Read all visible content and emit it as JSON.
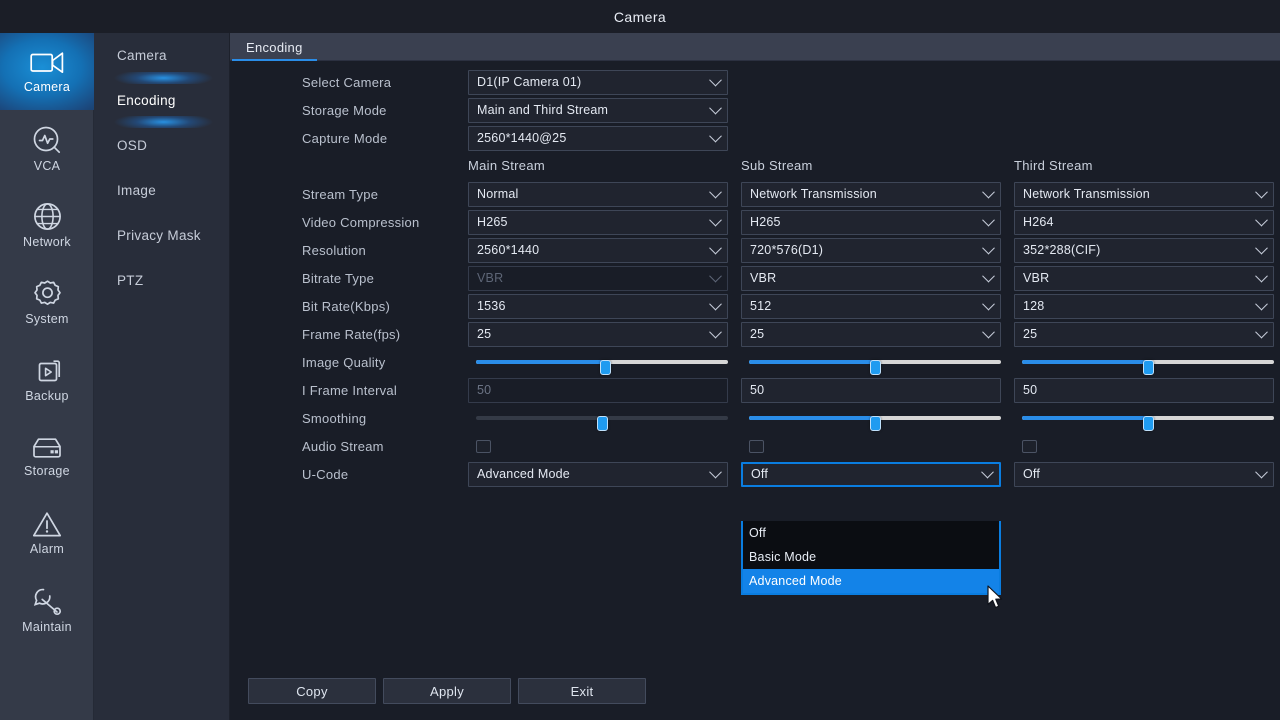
{
  "window": {
    "title": "Camera"
  },
  "rail": {
    "items": [
      {
        "label": "Camera",
        "icon": "camera-icon",
        "active": true
      },
      {
        "label": "VCA",
        "icon": "vca-icon",
        "active": false
      },
      {
        "label": "Network",
        "icon": "globe-icon",
        "active": false
      },
      {
        "label": "System",
        "icon": "gear-icon",
        "active": false
      },
      {
        "label": "Backup",
        "icon": "backup-icon",
        "active": false
      },
      {
        "label": "Storage",
        "icon": "storage-icon",
        "active": false
      },
      {
        "label": "Alarm",
        "icon": "warning-icon",
        "active": false
      },
      {
        "label": "Maintain",
        "icon": "wrench-icon",
        "active": false
      }
    ]
  },
  "submenu": {
    "items": [
      {
        "label": "Camera",
        "active": false
      },
      {
        "label": "Encoding",
        "active": true
      },
      {
        "label": "OSD",
        "active": false
      },
      {
        "label": "Image",
        "active": false
      },
      {
        "label": "Privacy Mask",
        "active": false
      },
      {
        "label": "PTZ",
        "active": false
      }
    ]
  },
  "tabs": [
    {
      "label": "Encoding",
      "active": true
    }
  ],
  "top_fields": [
    {
      "label": "Select Camera",
      "value": "D1(IP Camera 01)"
    },
    {
      "label": "Storage Mode",
      "value": "Main and Third Stream"
    },
    {
      "label": "Capture Mode",
      "value": "2560*1440@25"
    }
  ],
  "column_headers": [
    "Main Stream",
    "Sub Stream",
    "Third Stream"
  ],
  "rows": [
    {
      "label": "Stream Type",
      "cells": [
        {
          "type": "select",
          "value": "Normal",
          "disabled": false
        },
        {
          "type": "select",
          "value": "Network Transmission",
          "disabled": false
        },
        {
          "type": "select",
          "value": "Network Transmission",
          "disabled": false
        }
      ]
    },
    {
      "label": "Video Compression",
      "cells": [
        {
          "type": "select",
          "value": "H265",
          "disabled": false
        },
        {
          "type": "select",
          "value": "H265",
          "disabled": false
        },
        {
          "type": "select",
          "value": "H264",
          "disabled": false
        }
      ]
    },
    {
      "label": "Resolution",
      "cells": [
        {
          "type": "select",
          "value": "2560*1440",
          "disabled": false
        },
        {
          "type": "select",
          "value": "720*576(D1)",
          "disabled": false
        },
        {
          "type": "select",
          "value": "352*288(CIF)",
          "disabled": false
        }
      ]
    },
    {
      "label": "Bitrate Type",
      "cells": [
        {
          "type": "select",
          "value": "VBR",
          "disabled": true
        },
        {
          "type": "select",
          "value": "VBR",
          "disabled": false
        },
        {
          "type": "select",
          "value": "VBR",
          "disabled": false
        }
      ]
    },
    {
      "label": "Bit Rate(Kbps)",
      "cells": [
        {
          "type": "select",
          "value": "1536",
          "disabled": false
        },
        {
          "type": "select",
          "value": "512",
          "disabled": false
        },
        {
          "type": "select",
          "value": "128",
          "disabled": false
        }
      ]
    },
    {
      "label": "Frame Rate(fps)",
      "cells": [
        {
          "type": "select",
          "value": "25",
          "disabled": false
        },
        {
          "type": "select",
          "value": "25",
          "disabled": false
        },
        {
          "type": "select",
          "value": "25",
          "disabled": false
        }
      ]
    },
    {
      "label": "Image Quality",
      "cells": [
        {
          "type": "slider",
          "percent": 51,
          "disabled": false
        },
        {
          "type": "slider",
          "percent": 50,
          "disabled": false
        },
        {
          "type": "slider",
          "percent": 50,
          "disabled": false
        }
      ]
    },
    {
      "label": "I Frame Interval",
      "cells": [
        {
          "type": "text",
          "value": "50",
          "disabled": true
        },
        {
          "type": "text",
          "value": "50",
          "disabled": false
        },
        {
          "type": "text",
          "value": "50",
          "disabled": false
        }
      ]
    },
    {
      "label": "Smoothing",
      "cells": [
        {
          "type": "slider",
          "percent": 50,
          "disabled": true
        },
        {
          "type": "slider",
          "percent": 50,
          "disabled": false
        },
        {
          "type": "slider",
          "percent": 50,
          "disabled": false
        }
      ]
    },
    {
      "label": "Audio Stream",
      "cells": [
        {
          "type": "checkbox",
          "checked": false
        },
        {
          "type": "checkbox",
          "checked": false
        },
        {
          "type": "checkbox",
          "checked": false
        }
      ]
    },
    {
      "label": "U-Code",
      "cells": [
        {
          "type": "select",
          "value": "Advanced Mode",
          "disabled": false
        },
        {
          "type": "select",
          "value": "Off",
          "disabled": false,
          "opened": true
        },
        {
          "type": "select",
          "value": "Off",
          "disabled": false
        }
      ]
    }
  ],
  "dropdown": {
    "open_for": "U-Code Sub Stream",
    "options": [
      {
        "label": "Off",
        "selected": false
      },
      {
        "label": "Basic Mode",
        "selected": false
      },
      {
        "label": "Advanced Mode",
        "selected": true
      }
    ]
  },
  "footer": {
    "buttons": [
      {
        "label": "Copy"
      },
      {
        "label": "Apply"
      },
      {
        "label": "Exit"
      }
    ]
  },
  "colors": {
    "accent": "#2a8de8",
    "highlight": "#1383e8",
    "panel_bg": "#191d27",
    "rail_bg": "#343a48",
    "submenu_bg": "#282d3a",
    "tabbar_bg": "#3a4050"
  }
}
